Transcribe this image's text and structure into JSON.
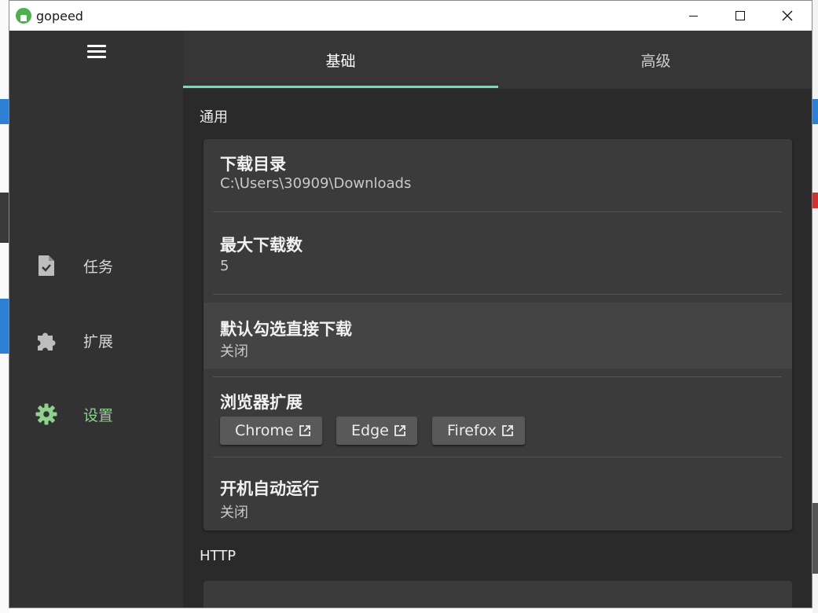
{
  "window": {
    "app_title": "gopeed"
  },
  "sidebar": {
    "items": [
      {
        "label": "任务",
        "icon": "task-file-icon",
        "active": false
      },
      {
        "label": "扩展",
        "icon": "puzzle-icon",
        "active": false
      },
      {
        "label": "设置",
        "icon": "gear-icon",
        "active": true
      }
    ]
  },
  "tabs": [
    {
      "label": "基础",
      "active": true
    },
    {
      "label": "高级",
      "active": false
    }
  ],
  "sections": {
    "general": {
      "title": "通用",
      "download_dir": {
        "title": "下载目录",
        "value": "C:\\Users\\30909\\Downloads"
      },
      "max_downloads": {
        "title": "最大下载数",
        "value": "5"
      },
      "default_direct_download": {
        "title": "默认勾选直接下载",
        "value": "关闭"
      },
      "browser_ext": {
        "title": "浏览器扩展",
        "buttons": [
          "Chrome",
          "Edge",
          "Firefox"
        ]
      },
      "autostart": {
        "title": "开机自动运行",
        "value": "关闭"
      }
    },
    "http": {
      "title": "HTTP"
    }
  },
  "colors": {
    "accent_tab": "#64e3c4",
    "active_nav": "#8fd18f",
    "logo": "#4caf50"
  }
}
